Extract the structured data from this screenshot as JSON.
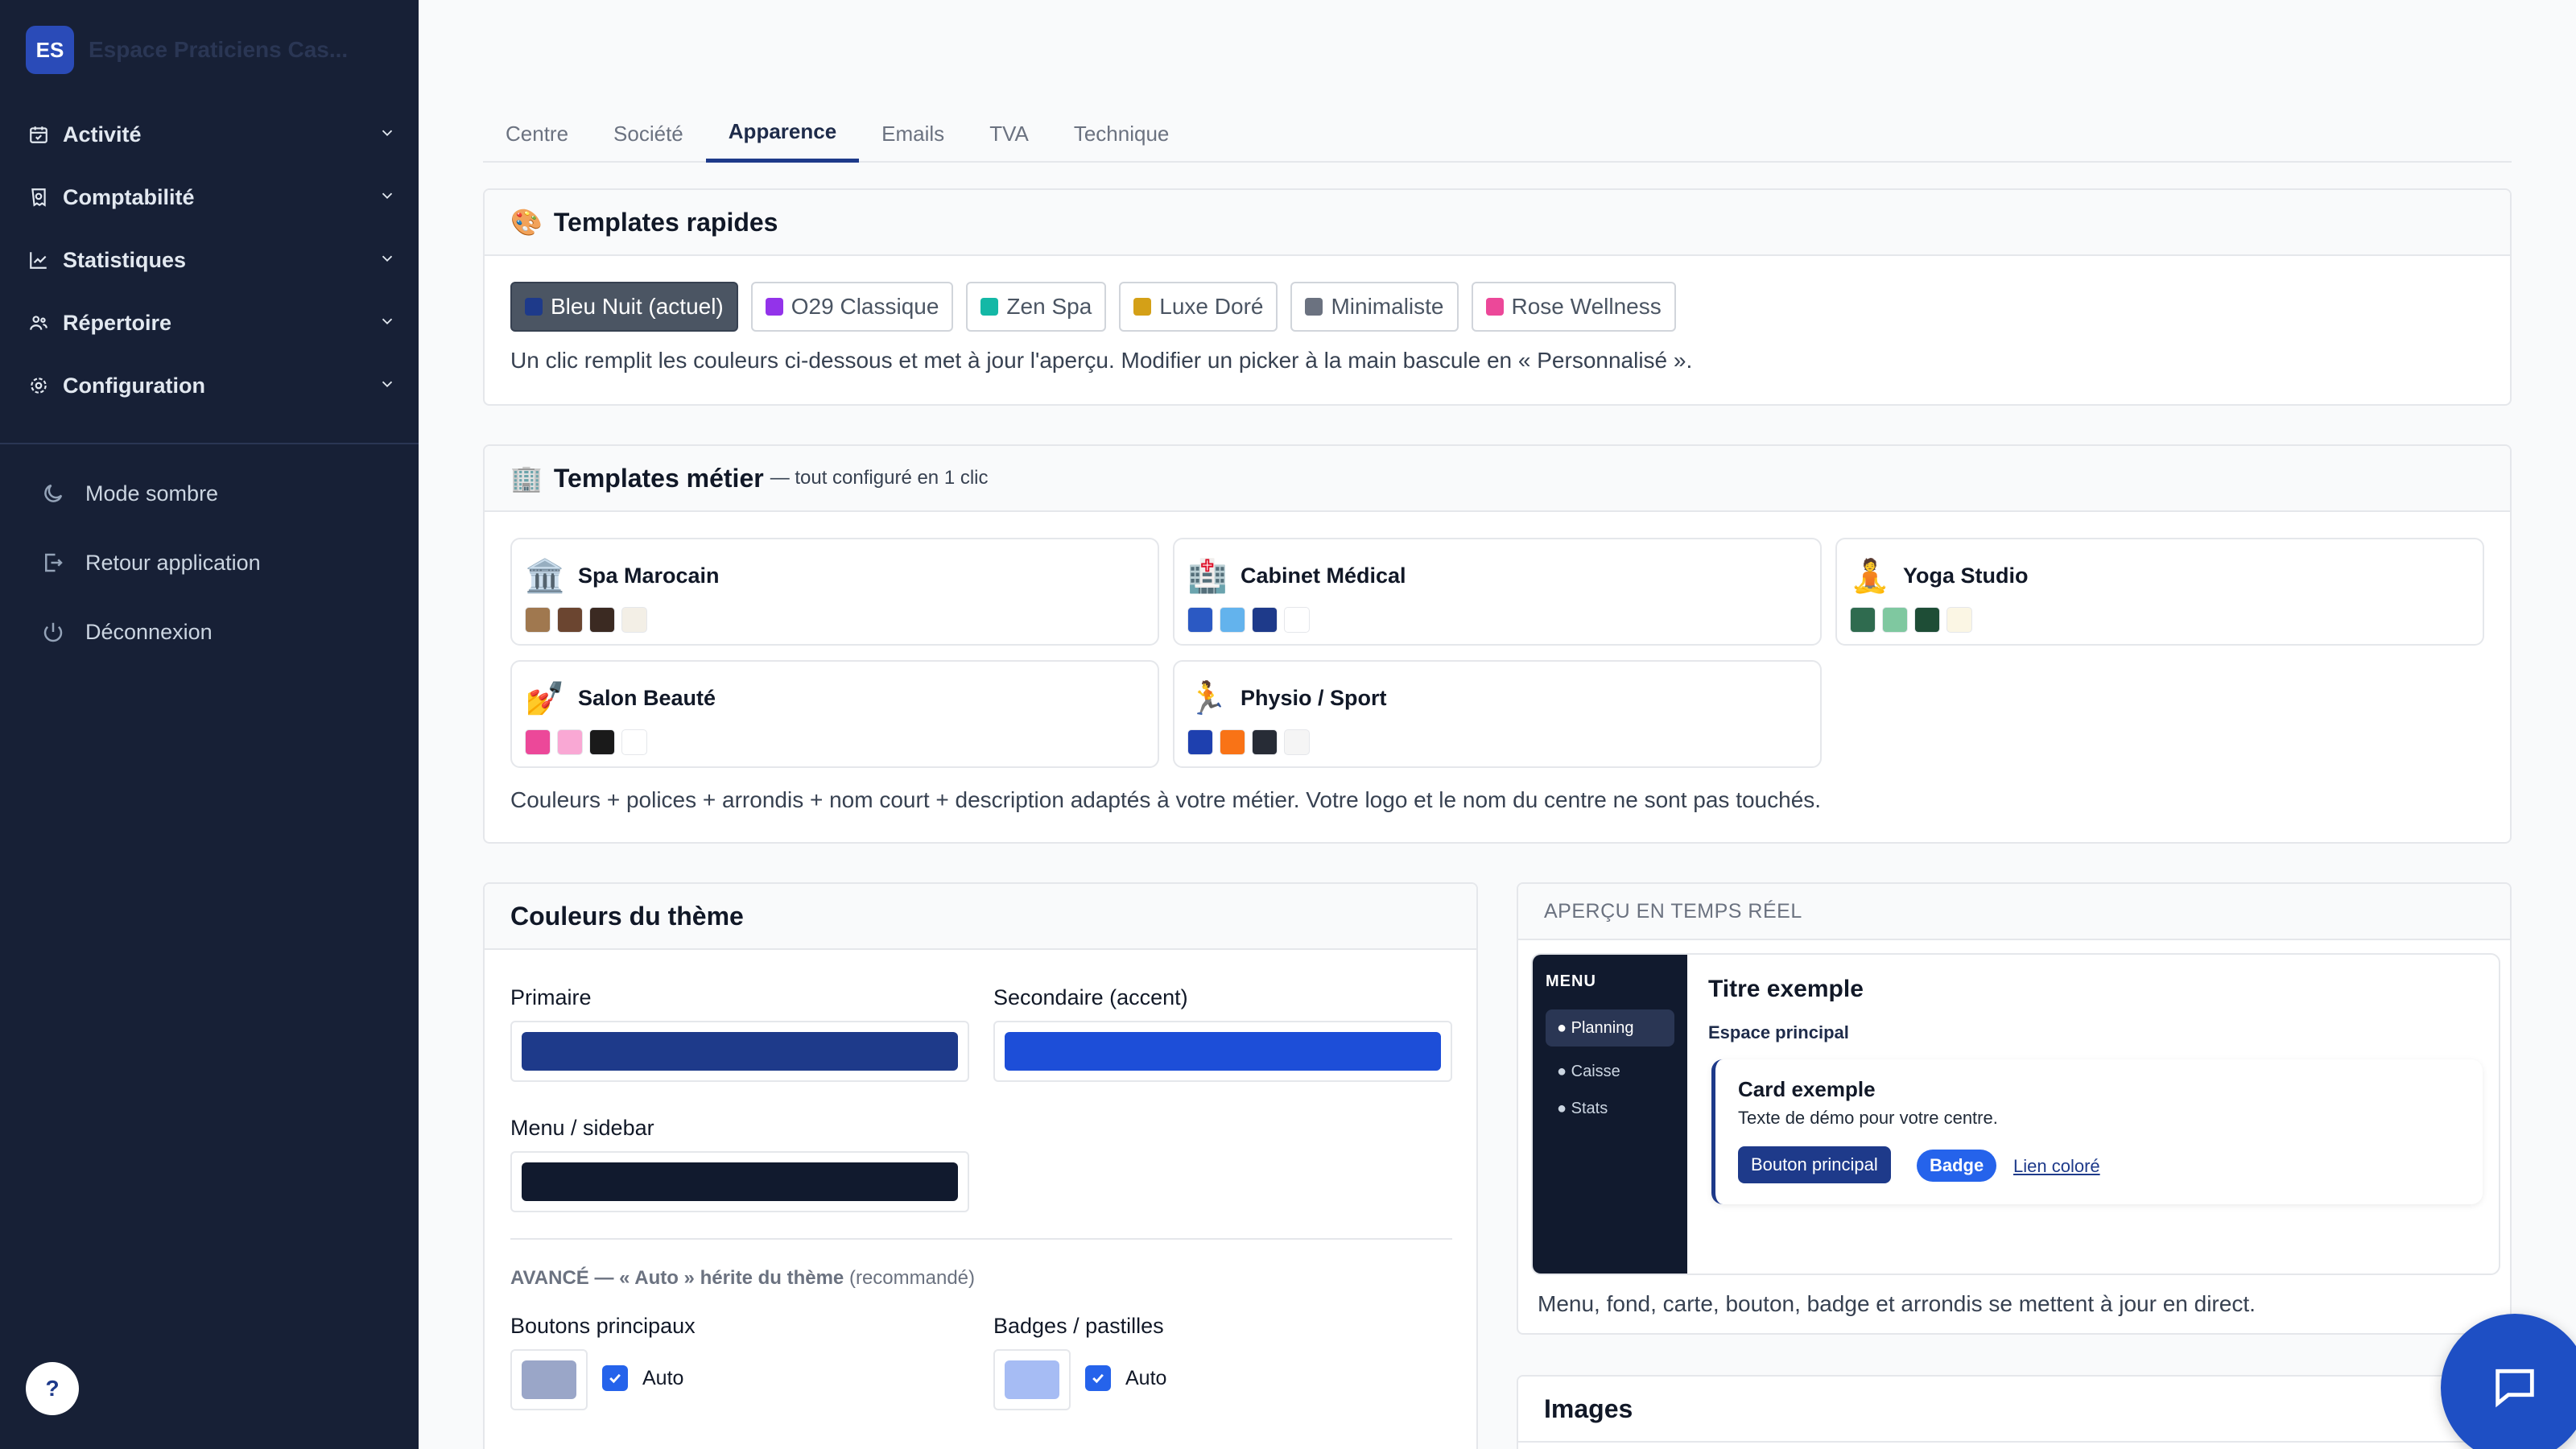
{
  "brand": {
    "initials": "ES",
    "name": "Espace Praticiens Cas..."
  },
  "nav": {
    "items": [
      {
        "label": "Activité",
        "icon": "calendar-check-icon"
      },
      {
        "label": "Comptabilité",
        "icon": "receipt-icon"
      },
      {
        "label": "Statistiques",
        "icon": "line-chart-icon"
      },
      {
        "label": "Répertoire",
        "icon": "users-icon"
      },
      {
        "label": "Configuration",
        "icon": "gear-icon"
      }
    ],
    "footer": [
      {
        "label": "Mode sombre",
        "icon": "moon-icon"
      },
      {
        "label": "Retour application",
        "icon": "exit-icon"
      },
      {
        "label": "Déconnexion",
        "icon": "power-icon"
      }
    ],
    "help": "?"
  },
  "tabs": [
    {
      "label": "Centre",
      "active": false
    },
    {
      "label": "Société",
      "active": false
    },
    {
      "label": "Apparence",
      "active": true
    },
    {
      "label": "Emails",
      "active": false
    },
    {
      "label": "TVA",
      "active": false
    },
    {
      "label": "Technique",
      "active": false
    }
  ],
  "quick": {
    "emoji": "🎨",
    "title": "Templates rapides",
    "templates": [
      {
        "label": "Bleu Nuit (actuel)",
        "color": "#1e3a8a",
        "active": true
      },
      {
        "label": "O29 Classique",
        "color": "#9333ea",
        "active": false
      },
      {
        "label": "Zen Spa",
        "color": "#14b8a6",
        "active": false
      },
      {
        "label": "Luxe Doré",
        "color": "#d4a017",
        "active": false
      },
      {
        "label": "Minimaliste",
        "color": "#6b7280",
        "active": false
      },
      {
        "label": "Rose Wellness",
        "color": "#ec4899",
        "active": false
      }
    ],
    "help": "Un clic remplit les couleurs ci-dessous et met à jour l'aperçu. Modifier un picker à la main bascule en « Personnalisé »."
  },
  "metier": {
    "emoji": "🏢",
    "title": "Templates métier",
    "subtitle": "— tout configuré en 1 clic",
    "items": [
      {
        "emoji": "🏛️",
        "name": "Spa Marocain",
        "colors": [
          "#a0784f",
          "#6b4530",
          "#3b2a22",
          "#f3efe6"
        ]
      },
      {
        "emoji": "🏥",
        "name": "Cabinet Médical",
        "colors": [
          "#2b59c3",
          "#63b3ed",
          "#1e3a8a",
          "#ffffff"
        ]
      },
      {
        "emoji": "🧘",
        "name": "Yoga Studio",
        "colors": [
          "#2f6b4f",
          "#7fc8a0",
          "#1e4d36",
          "#fbf6e4"
        ]
      },
      {
        "emoji": "💅",
        "name": "Salon Beauté",
        "colors": [
          "#ec4899",
          "#f9a8d4",
          "#1a1a1a",
          "#ffffff"
        ]
      },
      {
        "emoji": "🏃",
        "name": "Physio / Sport",
        "colors": [
          "#1e40af",
          "#f97316",
          "#272c36",
          "#f5f5f5"
        ]
      }
    ],
    "help": "Couleurs + polices + arrondis + nom court + description adaptés à votre métier. Votre logo et le nom du centre ne sont pas touchés."
  },
  "theme": {
    "title": "Couleurs du thème",
    "primary": {
      "label": "Primaire",
      "color": "#1e3a8a"
    },
    "secondary": {
      "label": "Secondaire (accent)",
      "color": "#1d4ed8"
    },
    "sidebar": {
      "label": "Menu / sidebar",
      "color": "#111a2e"
    },
    "advanced": {
      "bold": "AVANCÉ — « Auto » hérite du thème",
      "rest": "(recommandé)"
    },
    "buttons": {
      "label": "Boutons principaux",
      "color": "#9aa6c8",
      "auto": "Auto"
    },
    "badges": {
      "label": "Badges / pastilles",
      "color": "#a6bcf4",
      "auto": "Auto"
    }
  },
  "preview": {
    "label": "APERÇU EN TEMPS RÉEL",
    "menu_title": "MENU",
    "menu_items": [
      "● Planning",
      "● Caisse",
      "● Stats"
    ],
    "title": "Titre exemple",
    "subtitle": "Espace principal",
    "card_title": "Card exemple",
    "card_desc": "Texte de démo pour votre centre.",
    "button": "Bouton principal",
    "badge": "Badge",
    "link": "Lien coloré",
    "help": "Menu, fond, carte, bouton, badge et arrondis se mettent à jour en direct."
  },
  "images": {
    "title": "Images"
  }
}
